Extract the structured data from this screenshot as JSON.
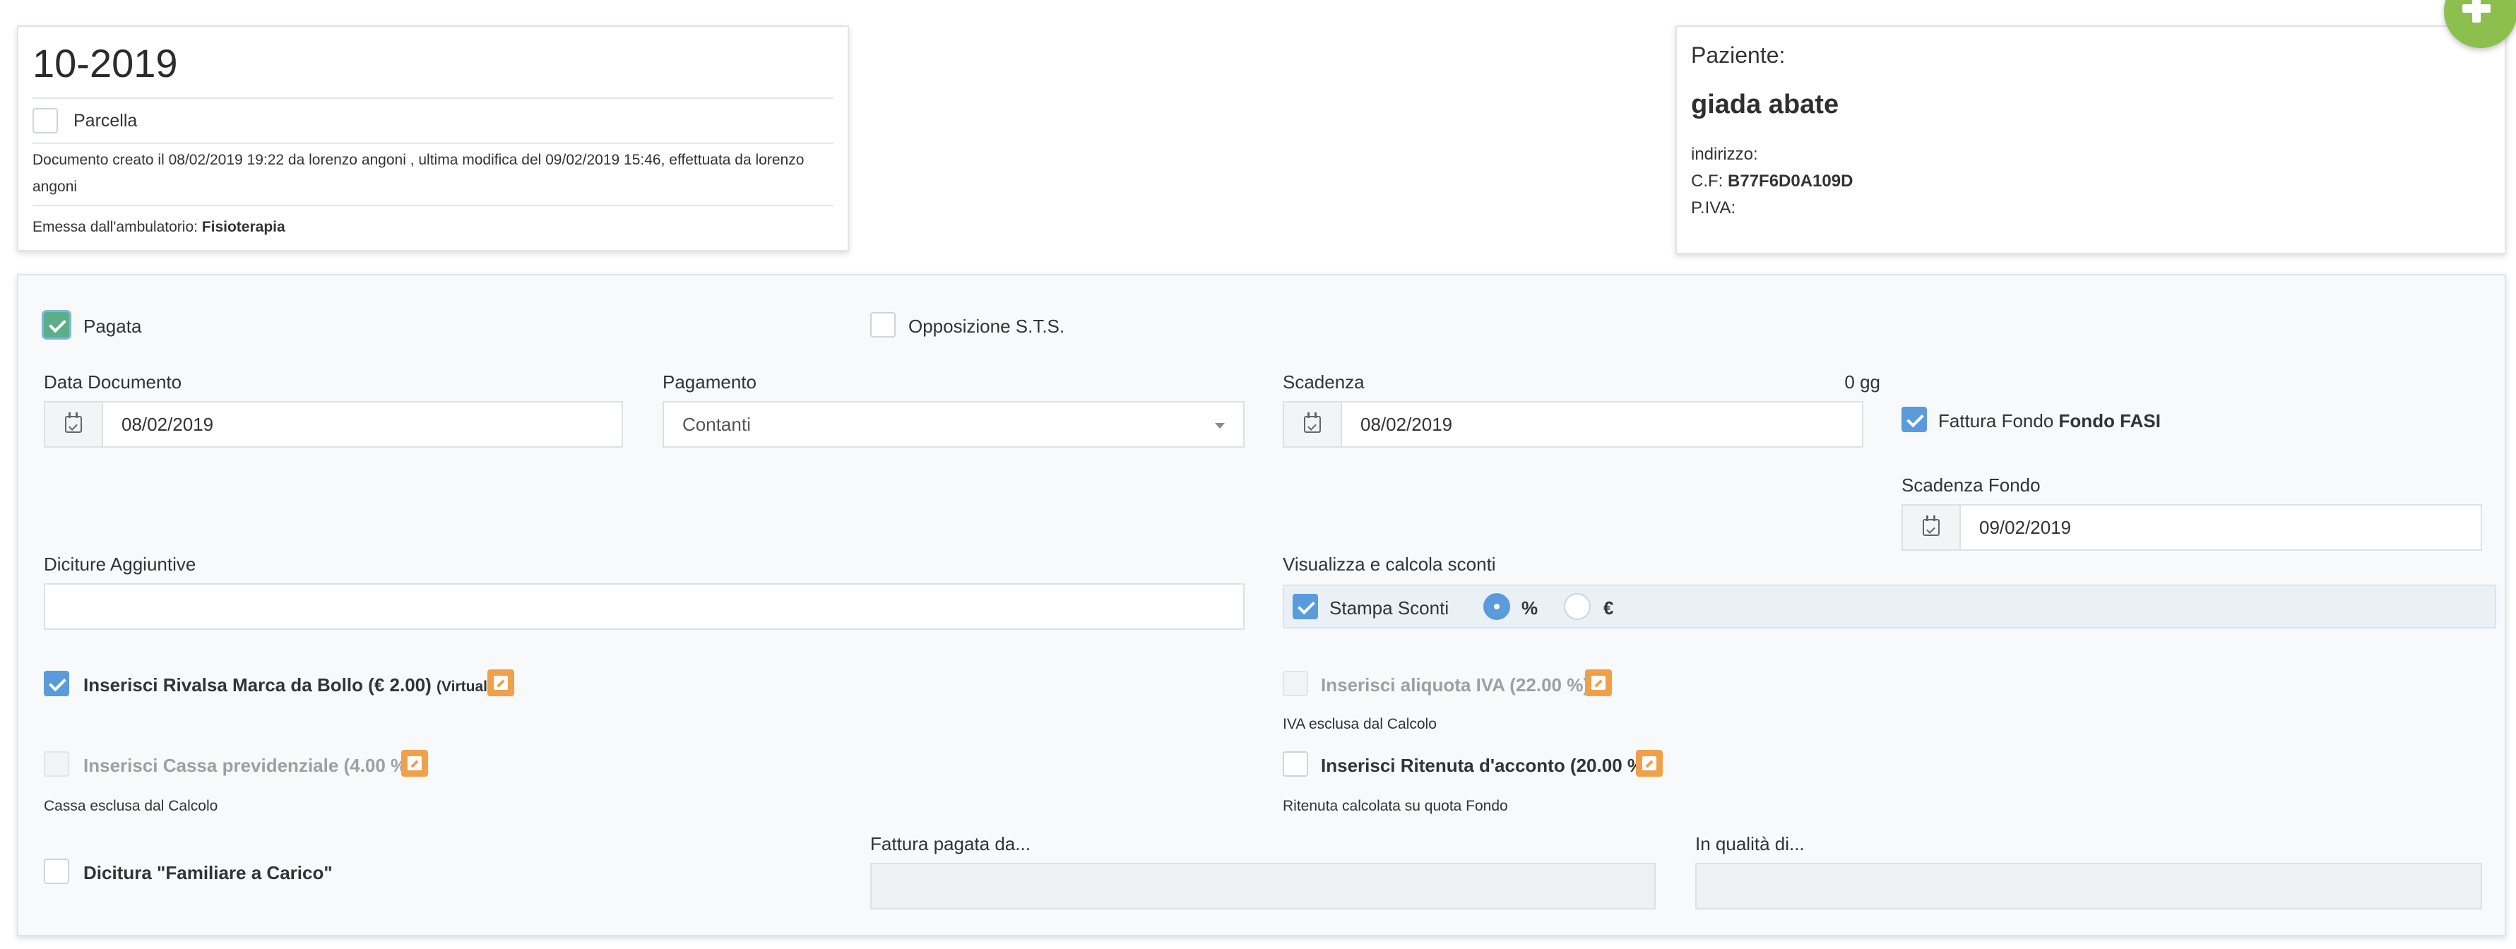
{
  "document": {
    "number": "10-2019",
    "parcella_label": "Parcella",
    "meta": "Documento creato il 08/02/2019 19:22 da lorenzo angoni , ultima modifica del 09/02/2019 15:46, effettuata da lorenzo angoni",
    "emessa_prefix": "Emessa dall'ambulatorio:",
    "ambulatorio": "Fisioterapia"
  },
  "patient": {
    "title": "Paziente:",
    "name": "giada abate",
    "indirizzo_label": "indirizzo:",
    "cf_label": "C.F:",
    "cf_value": "B77F6D0A109D",
    "piva_label": "P.IVA:"
  },
  "form": {
    "pagata_label": "Pagata",
    "opposizione_label": "Opposizione S.T.S.",
    "data_documento_label": "Data Documento",
    "data_documento_value": "08/02/2019",
    "pagamento_label": "Pagamento",
    "pagamento_value": "Contanti",
    "scadenza_label": "Scadenza",
    "scadenza_days": "0 gg",
    "scadenza_value": "08/02/2019",
    "fattura_fondo_label": "Fattura Fondo",
    "fattura_fondo_name": "Fondo FASI",
    "scadenza_fondo_label": "Scadenza Fondo",
    "scadenza_fondo_value": "09/02/2019",
    "diciture_label": "Diciture Aggiuntive",
    "diciture_value": "",
    "sconti_label": "Visualizza e calcola sconti",
    "stampa_sconti_label": "Stampa Sconti",
    "percent_label": "%",
    "euro_label": "€",
    "rivalsa_label": "Inserisci Rivalsa Marca da Bollo (€ 2.00)",
    "rivalsa_suffix": "(Virtuale)",
    "iva_label": "Inserisci aliquota IVA (22.00 %)",
    "iva_note": "IVA esclusa dal Calcolo",
    "cassa_label": "Inserisci Cassa previdenziale (4.00 %)",
    "cassa_note": "Cassa esclusa dal Calcolo",
    "ritenuta_label": "Inserisci Ritenuta d'acconto (20.00 %)",
    "ritenuta_note": "Ritenuta calcolata su quota Fondo",
    "fattura_pagata_label": "Fattura pagata da...",
    "in_qualita_label": "In qualità di...",
    "familiare_label": "Dicitura \"Familiare a Carico\""
  },
  "colors": {
    "accent_blue": "#5a9bdb",
    "check_green": "#5aae8a",
    "edit_orange": "#f0a04b",
    "fab_green": "#8cbf4d"
  }
}
